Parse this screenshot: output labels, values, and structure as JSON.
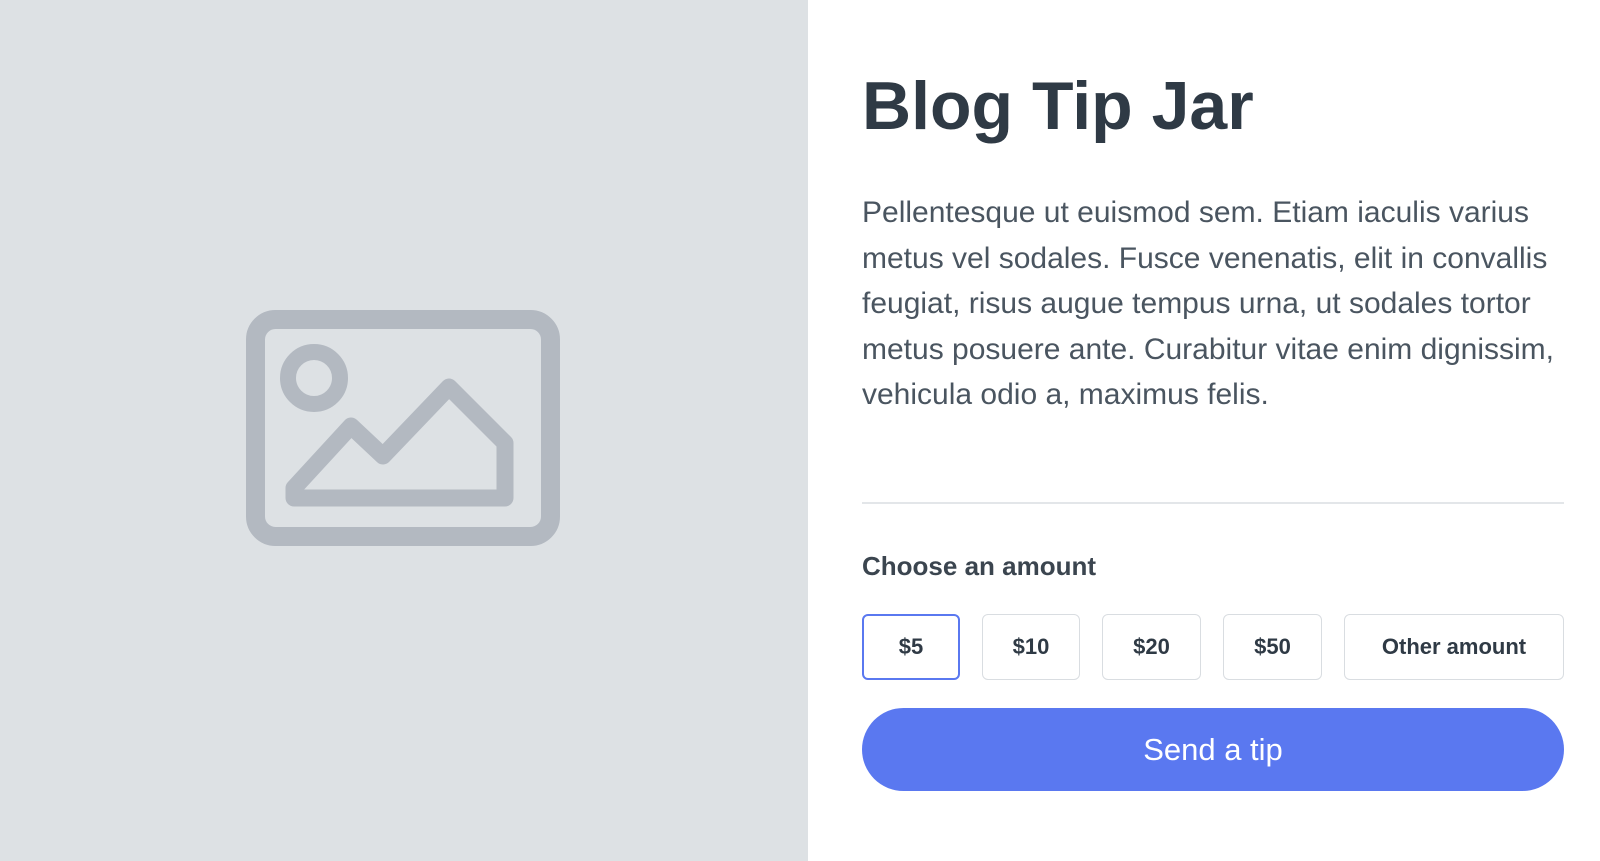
{
  "image_panel": {
    "icon": "image-placeholder-icon",
    "background_color": "#dde1e4",
    "icon_color": "#b3b9c1"
  },
  "title": "Blog Tip Jar",
  "description": "Pellentesque ut euismod sem. Etiam iaculis varius metus vel sodales. Fusce venenatis, elit in convallis feugiat, risus augue tempus urna, ut sodales tortor metus posuere ante. Curabitur vitae enim dignissim, vehicula odio a, maximus felis.",
  "amount_section": {
    "label": "Choose an amount",
    "options": [
      {
        "label": "$5",
        "selected": true
      },
      {
        "label": "$10",
        "selected": false
      },
      {
        "label": "$20",
        "selected": false
      },
      {
        "label": "$50",
        "selected": false
      },
      {
        "label": "Other amount",
        "selected": false
      }
    ]
  },
  "send_button": {
    "label": "Send a tip"
  },
  "colors": {
    "accent": "#5a78f0",
    "text_dark": "#2f3a45",
    "text_body": "#4a5560",
    "divider": "#e3e6e9"
  }
}
